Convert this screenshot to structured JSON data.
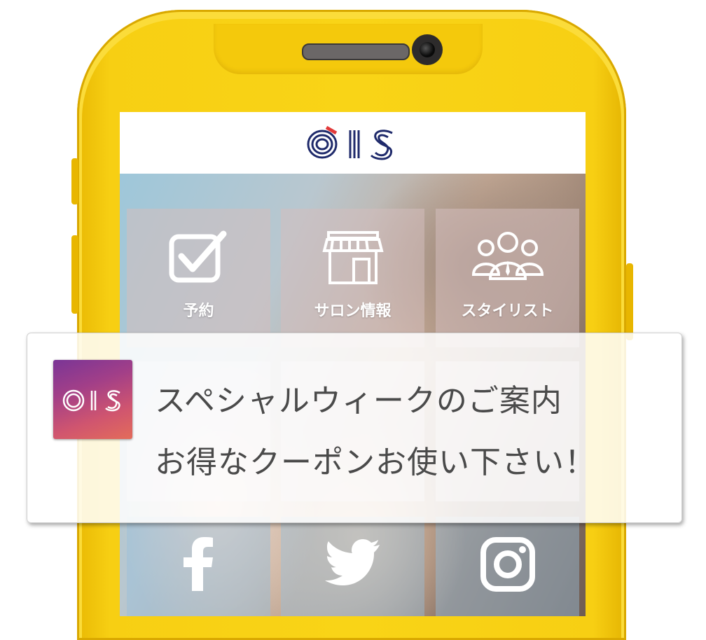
{
  "header": {
    "logo_text": "OIS"
  },
  "menu": {
    "items": [
      {
        "label": "予約",
        "icon": "checkbox-icon"
      },
      {
        "label": "サロン情報",
        "icon": "storefront-icon"
      },
      {
        "label": "スタイリスト",
        "icon": "people-icon"
      }
    ],
    "social": [
      {
        "icon": "facebook-icon"
      },
      {
        "icon": "twitter-icon"
      },
      {
        "icon": "instagram-icon"
      }
    ]
  },
  "notification": {
    "app_icon_text": "OIS",
    "line1": "スペシャルウィークのご案内",
    "line2": "お得なクーポンお使い下さい！"
  },
  "colors": {
    "phone_body": "#f9d417",
    "logo_navy": "#1f2a6b",
    "logo_red": "#e23a3a",
    "notif_icon_gradient": [
      "#7a3596",
      "#e36c5a"
    ]
  }
}
